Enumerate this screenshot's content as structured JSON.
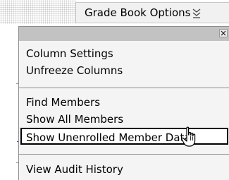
{
  "toolbar": {
    "options_label": "Grade Book Options",
    "options_icon": "double-chevron-down-icon"
  },
  "menu": {
    "close_icon": "close-icon",
    "groups": [
      {
        "items": [
          {
            "label": "Column Settings"
          },
          {
            "label": "Unfreeze Columns"
          }
        ]
      },
      {
        "items": [
          {
            "label": "Find Members"
          },
          {
            "label": "Show All Members"
          },
          {
            "label": "Show Unenrolled Member Data"
          }
        ]
      },
      {
        "items": [
          {
            "label": "View Audit History"
          }
        ]
      }
    ],
    "highlighted_item": "Show Unenrolled Member Data"
  },
  "cursor": {
    "icon": "hand-pointer-icon"
  },
  "colors": {
    "menu_background": "#f4f4f4",
    "menu_titlebar": "#c2c2c2",
    "button_background": "#f1f1f1",
    "highlight_border": "#000000"
  }
}
